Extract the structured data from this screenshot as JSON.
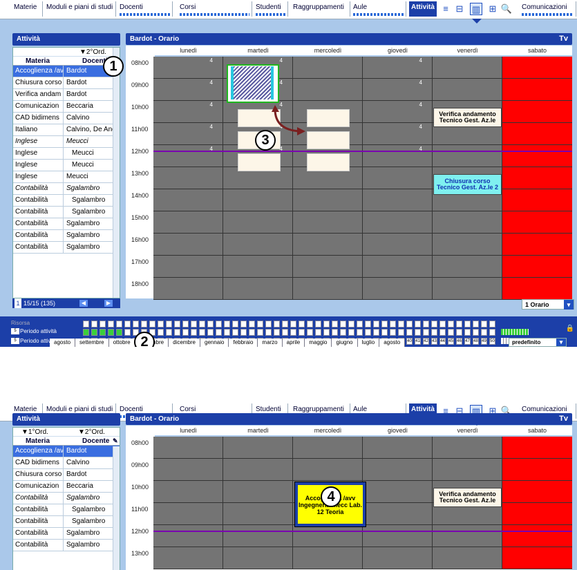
{
  "tabs": [
    {
      "label": "Materie",
      "dots": false
    },
    {
      "label": "Moduli e piani di studi",
      "dots": false
    },
    {
      "label": "Docenti",
      "dots": true
    },
    {
      "label": "Corsi",
      "dots": true
    },
    {
      "label": "Studenti",
      "dots": true
    },
    {
      "label": "Raggruppamenti",
      "dots": false
    },
    {
      "label": "Aule",
      "dots": true
    },
    {
      "label": "Attività",
      "dots": false
    },
    {
      "label": "Comunicazioni",
      "dots": true
    }
  ],
  "icons": [
    "list-icon",
    "column-icon",
    "timetable-icon",
    "grid-icon",
    "search-icon"
  ],
  "top": {
    "left_title": "Attività",
    "sort1": "",
    "sort2": "▼2°Ord.",
    "col_materia": "Materia",
    "col_docente": "Docenti",
    "rows": [
      {
        "m": "Accoglienza /av",
        "d": "Bardot",
        "style": "sel"
      },
      {
        "m": "Chiusura corso",
        "d": "Bardot",
        "style": ""
      },
      {
        "m": "Verifica andam",
        "d": "Bardot",
        "style": ""
      },
      {
        "m": "Comunicazion",
        "d": "Beccaria",
        "style": ""
      },
      {
        "m": "CAD bidimens",
        "d": "Calvino",
        "style": ""
      },
      {
        "m": "Italiano",
        "d": "Calvino, De And",
        "style": ""
      },
      {
        "m": "Inglese",
        "d": "Meucci",
        "style": "it"
      },
      {
        "m": "Inglese",
        "d": "Meucci",
        "style": "right"
      },
      {
        "m": "Inglese",
        "d": "Meucci",
        "style": "right"
      },
      {
        "m": "Inglese",
        "d": "Meucci",
        "style": ""
      },
      {
        "m": "Contabilità",
        "d": "Sgalambro",
        "style": "it"
      },
      {
        "m": "Contabilità",
        "d": "Sgalambro",
        "style": "right"
      },
      {
        "m": "Contabilità",
        "d": "Sgalambro",
        "style": "right"
      },
      {
        "m": "Contabilità",
        "d": "Sgalambro",
        "style": ""
      },
      {
        "m": "Contabilità",
        "d": "Sgalambro",
        "style": ""
      },
      {
        "m": "Contabilità",
        "d": "Sgalambro",
        "style": ""
      }
    ],
    "footer": "15/15  (135)",
    "grid_title": "Bardot - Orario",
    "tv": "Tv",
    "days": [
      "lunedì",
      "martedì",
      "mercoledì",
      "giovedì",
      "venerdì",
      "sabato"
    ],
    "hours": [
      "08h00",
      "09h00",
      "10h00",
      "11h00",
      "12h00",
      "13h00",
      "14h00",
      "15h00",
      "16h00",
      "17h00",
      "18h00"
    ],
    "cell_number": "4",
    "act_verifica": "Verifica andamento Tecnico Gest. Az.le",
    "act_chiusura": "Chiusura corso Tecnico Gest. Az.le 2",
    "orario_select": "1 Orario",
    "risorsa": "Risorsa",
    "periodo_attivita": "Periodo attività",
    "periodo_attivo": "Periodo attivo",
    "months": [
      "agosto",
      "settembre",
      "ottobre",
      "novembre",
      "dicembre",
      "gennaio",
      "febbraio",
      "marzo",
      "aprile",
      "maggio",
      "giugno",
      "luglio",
      "agosto"
    ],
    "predefinito": "predefinito",
    "badges": [
      "1",
      "2",
      "3"
    ]
  },
  "bottom": {
    "left_title": "Attività",
    "sort1": "▼1°Ord.",
    "sort2": "▼2°Ord.",
    "col_materia": "Materia",
    "col_docente": "Docente",
    "rows": [
      {
        "m": "Accoglienza /av",
        "d": "Bardot",
        "style": "sel"
      },
      {
        "m": "CAD bidimens",
        "d": "Calvino",
        "style": ""
      },
      {
        "m": "Chiusura corso",
        "d": "Bardot",
        "style": ""
      },
      {
        "m": "Comunicazion",
        "d": "Beccaria",
        "style": ""
      },
      {
        "m": "Contabilità",
        "d": "Sgalambro",
        "style": "it"
      },
      {
        "m": "Contabilità",
        "d": "Sgalambro",
        "style": "right"
      },
      {
        "m": "Contabilità",
        "d": "Sgalambro",
        "style": "right"
      },
      {
        "m": "Contabilità",
        "d": "Sgalambro",
        "style": ""
      },
      {
        "m": "Contabilità",
        "d": "Sgalambro",
        "style": ""
      }
    ],
    "grid_title": "Bardot - Orario",
    "tv": "Tv",
    "days": [
      "lunedì",
      "martedì",
      "mercoledì",
      "giovedì",
      "venerdì",
      "sabato"
    ],
    "hours": [
      "08h00",
      "09h00",
      "10h00",
      "11h00",
      "12h00",
      "13h00"
    ],
    "act_placed": "Accoglienza /avv Ingegneria mecc Lab. 12 Teoria",
    "act_verifica": "Verifica andamento Tecnico Gest. Az.le",
    "badge": "4"
  },
  "colors": {
    "accent": "#1c3fa8",
    "cell": "#747474",
    "saturday": "#ff0000",
    "slot": "#fdf6e8",
    "purple_line": "#7a00b0"
  }
}
